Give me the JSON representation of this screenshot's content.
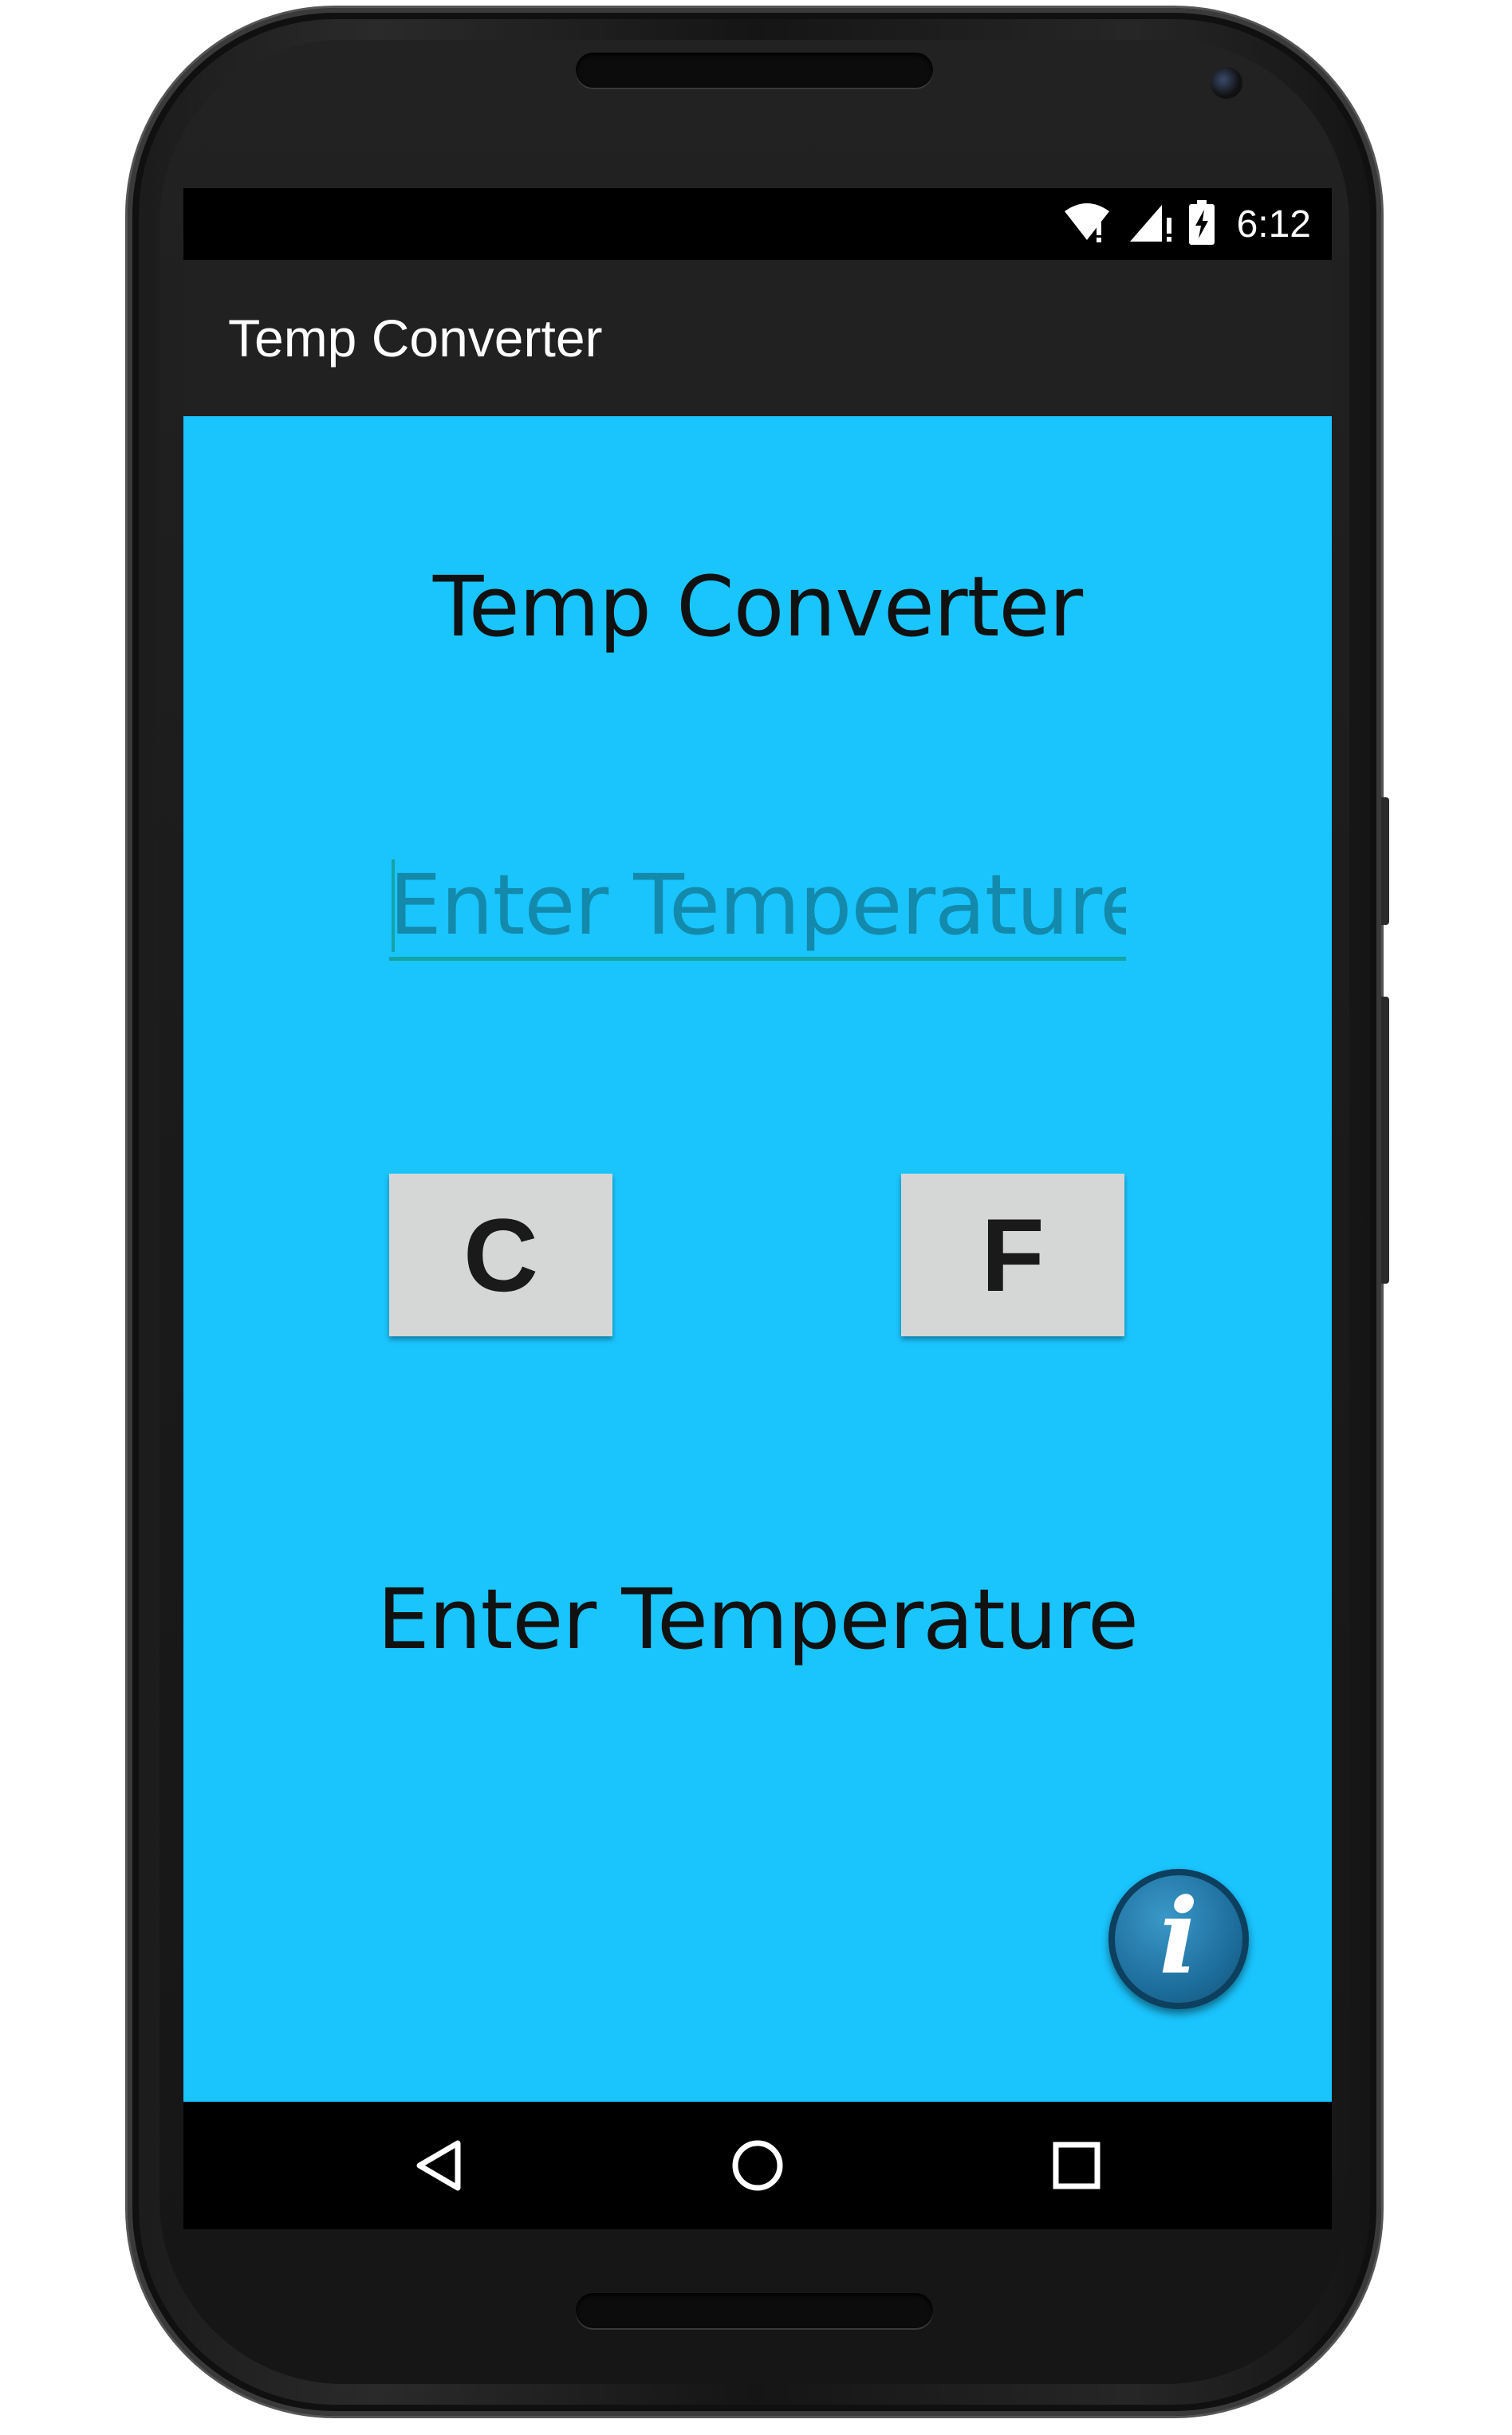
{
  "status_bar": {
    "time": "6:12",
    "icons": [
      "wifi-icon",
      "cell-signal-icon",
      "battery-charging-icon"
    ]
  },
  "action_bar": {
    "title": "Temp Converter"
  },
  "main": {
    "heading": "Temp Converter",
    "input": {
      "value": "",
      "placeholder": "Enter Temperature"
    },
    "buttons": {
      "celsius_label": "C",
      "fahrenheit_label": "F"
    },
    "result": "Enter Temperature",
    "info_icon": "info-icon"
  },
  "nav_bar": {
    "items": [
      "back-icon",
      "home-icon",
      "recents-icon"
    ]
  },
  "colors": {
    "content_background": "#1ac4fd",
    "action_bar": "#212121",
    "input_underline": "#14a3a8",
    "button_face": "#d5d6d6"
  }
}
